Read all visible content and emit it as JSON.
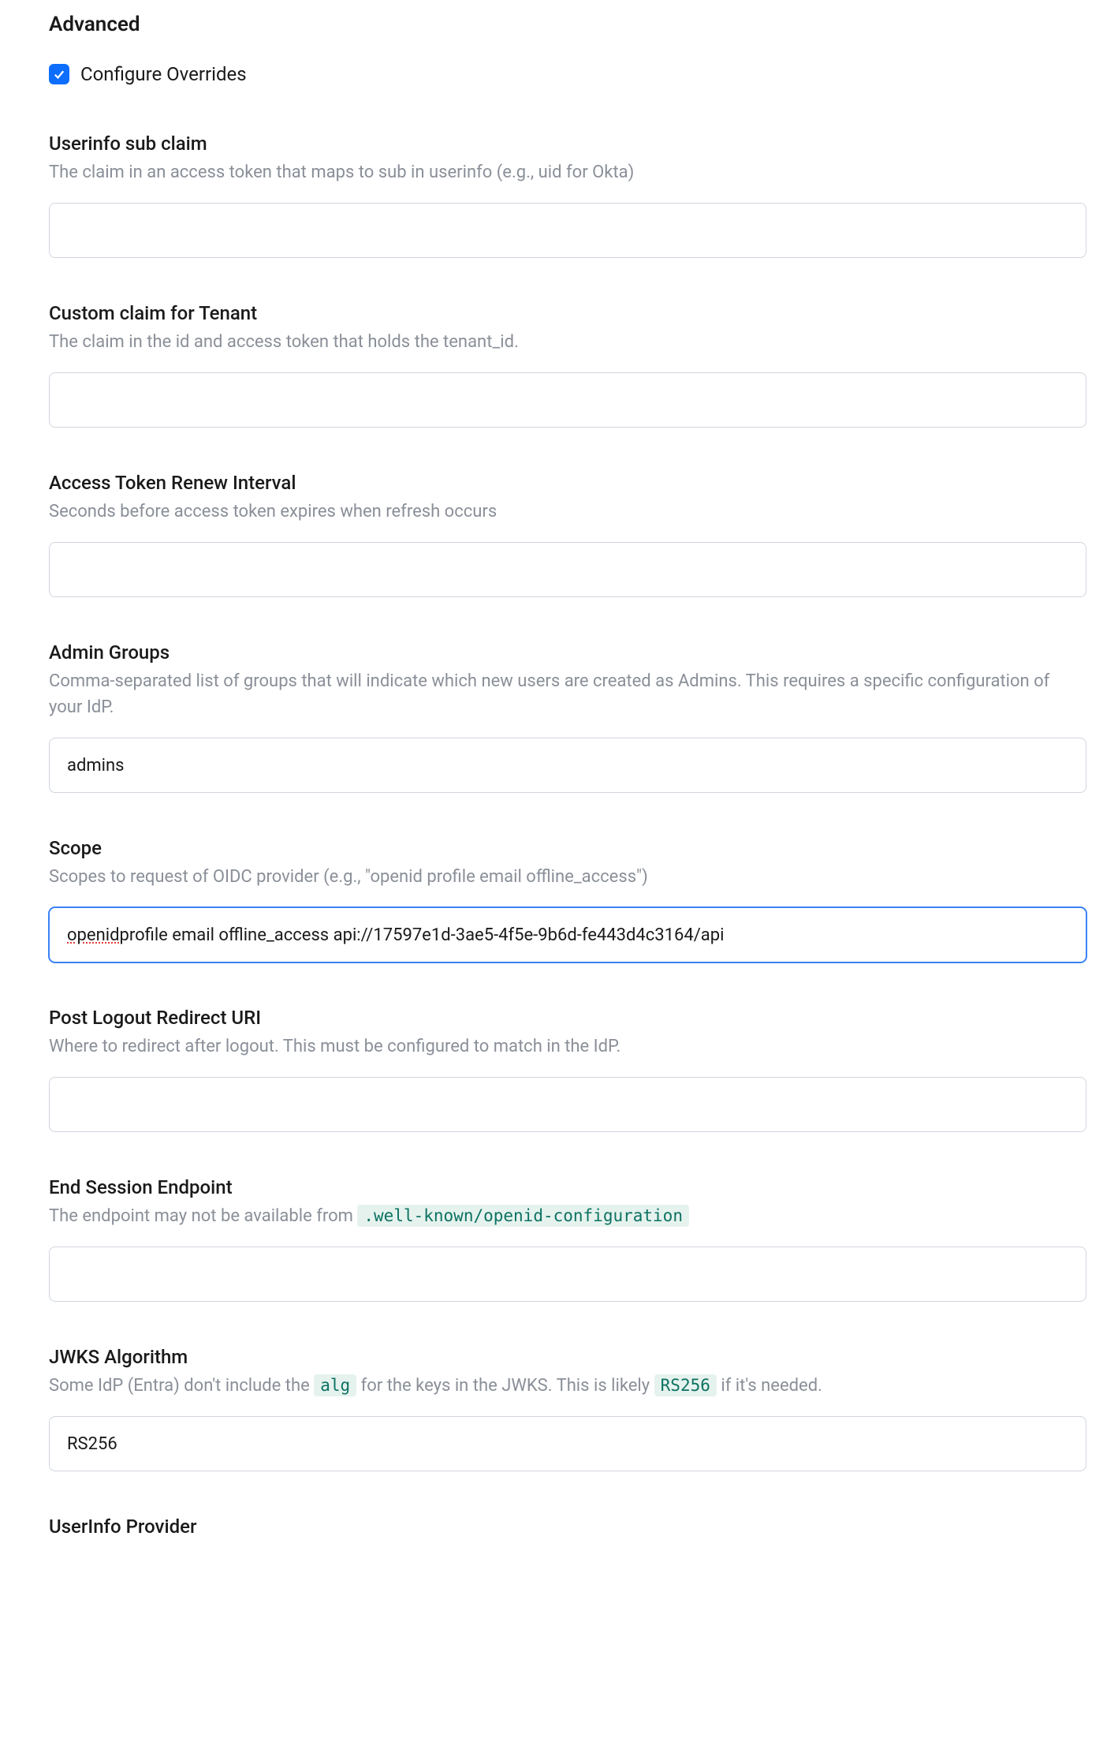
{
  "section": {
    "title": "Advanced",
    "configureOverrides": {
      "label": "Configure Overrides",
      "checked": true
    }
  },
  "fields": {
    "userinfoSub": {
      "label": "Userinfo sub claim",
      "desc": "The claim in an access token that maps to sub in userinfo (e.g., uid for Okta)",
      "value": ""
    },
    "customClaimTenant": {
      "label": "Custom claim for Tenant",
      "desc": "The claim in the id and access token that holds the tenant_id.",
      "value": ""
    },
    "accessTokenRenew": {
      "label": "Access Token Renew Interval",
      "desc": "Seconds before access token expires when refresh occurs",
      "value": ""
    },
    "adminGroups": {
      "label": "Admin Groups",
      "desc": "Comma-separated list of groups that will indicate which new users are created as Admins. This requires a specific configuration of your IdP.",
      "value": "admins"
    },
    "scope": {
      "label": "Scope",
      "desc": "Scopes to request of OIDC provider (e.g., \"openid profile email offline_access\")",
      "valueMisspelled": "openid",
      "valueRest": " profile email offline_access api://17597e1d-3ae5-4f5e-9b6d-fe443d4c3164/api"
    },
    "postLogout": {
      "label": "Post Logout Redirect URI",
      "desc": "Where to redirect after logout. This must be configured to match in the IdP.",
      "value": ""
    },
    "endSession": {
      "label": "End Session Endpoint",
      "descPre": "The endpoint may not be available from ",
      "descCode": ".well-known/openid-configuration",
      "value": ""
    },
    "jwksAlg": {
      "label": "JWKS Algorithm",
      "descPre": "Some IdP (Entra) don't include the ",
      "descCode1": "alg",
      "descMid": " for the keys in the JWKS. This is likely ",
      "descCode2": "RS256",
      "descPost": " if it's needed.",
      "value": "RS256"
    },
    "userinfoProvider": {
      "label": "UserInfo Provider"
    }
  }
}
